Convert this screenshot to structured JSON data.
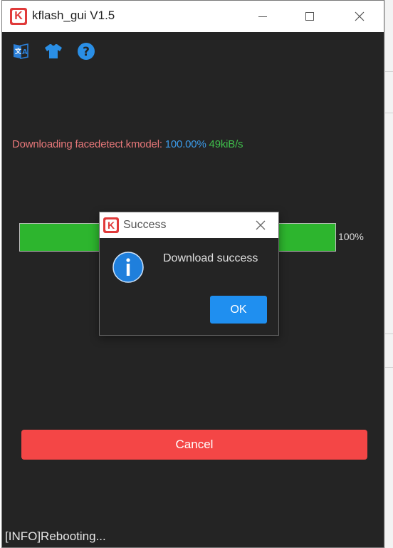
{
  "window": {
    "title": "kflash_gui V1.5",
    "logo_letter": "K"
  },
  "toolbar": {
    "icons": [
      "language-icon",
      "skin-icon",
      "help-icon"
    ]
  },
  "status": {
    "file_text": "Downloading facedetect.kmodel: ",
    "percent_text": "100.00%",
    "speed_text": " 49kiB/s"
  },
  "progress": {
    "value_percent": 100,
    "label": "100%"
  },
  "actions": {
    "cancel_label": "Cancel"
  },
  "log": {
    "last_line": "[INFO]Rebooting..."
  },
  "dialog": {
    "title": "Success",
    "message": "Download success",
    "ok_label": "OK",
    "logo_letter": "K"
  },
  "colors": {
    "background": "#242424",
    "progress": "#2db52e",
    "cancel": "#f44646",
    "ok": "#1f8ff0",
    "file_text": "#e8787a",
    "percent_text": "#3b9ae8",
    "speed_text": "#3fbf4b"
  }
}
